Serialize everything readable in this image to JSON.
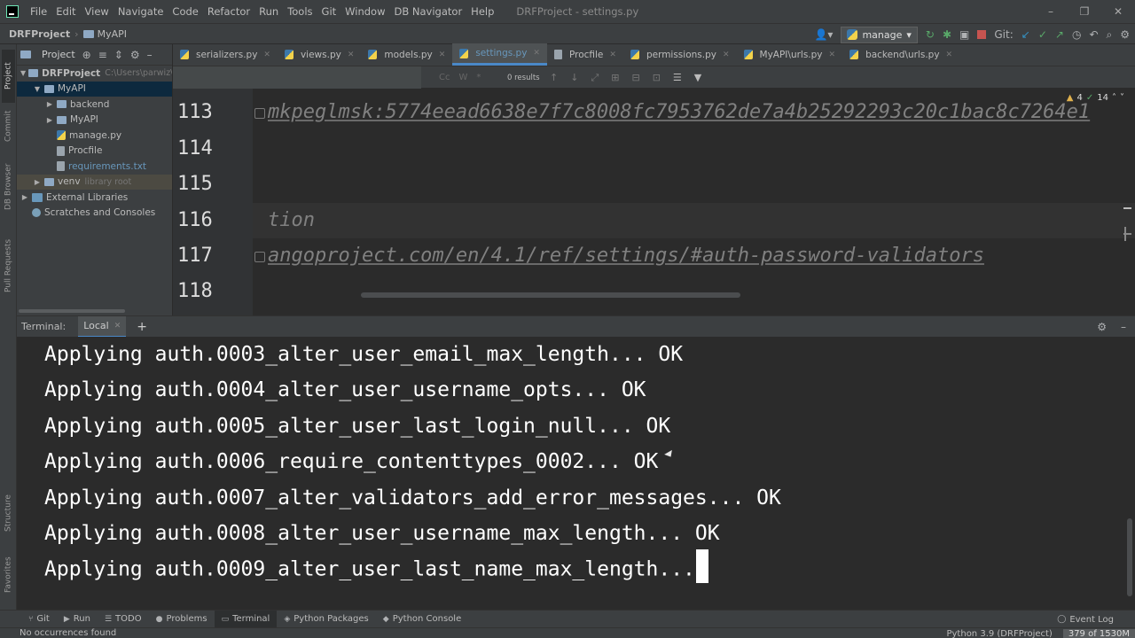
{
  "menu": {
    "items": [
      "File",
      "Edit",
      "View",
      "Navigate",
      "Code",
      "Refactor",
      "Run",
      "Tools",
      "Git",
      "Window",
      "DB Navigator",
      "Help"
    ],
    "window_title": "DRFProject - settings.py",
    "controls": [
      "–",
      "❐",
      "✕"
    ]
  },
  "navbar": {
    "project": "DRFProject",
    "module": "MyAPI",
    "run_config": "manage",
    "git_label": "Git:"
  },
  "left_strip": {
    "project": "Project",
    "commit": "Commit",
    "db_browser": "DB Browser",
    "pull_requests": "Pull Requests",
    "structure": "Structure",
    "favorites": "Favorites"
  },
  "project_panel": {
    "title": "Project",
    "tree": [
      {
        "label": "DRFProject",
        "hint": "C:\\Users\\parwiz\\Py"
      },
      {
        "label": "MyAPI"
      },
      {
        "label": "backend"
      },
      {
        "label": "MyAPI"
      },
      {
        "label": "manage.py"
      },
      {
        "label": "Procfile"
      },
      {
        "label": "requirements.txt"
      },
      {
        "label": "venv",
        "hint": "library root"
      },
      {
        "label": "External Libraries"
      },
      {
        "label": "Scratches and Consoles"
      }
    ]
  },
  "editor": {
    "tabs": [
      "serializers.py",
      "views.py",
      "models.py",
      "settings.py",
      "Procfile",
      "permissions.py",
      "MyAPI\\urls.py",
      "backend\\urls.py"
    ],
    "active_tab": "settings.py",
    "search": {
      "results": "0 results",
      "opt_case": "Cc",
      "opt_word": "W",
      "opt_regex": "*"
    },
    "inspections": {
      "warnings": "4",
      "ok": "14"
    },
    "lines": [
      {
        "num": "113",
        "text": "mkpeglmsk:5774eead6638e7f7c8008fc7953762de7a4b25292293c20c1bac8c7264e1"
      },
      {
        "num": "114",
        "text": ""
      },
      {
        "num": "115",
        "text": ""
      },
      {
        "num": "116",
        "text": "tion"
      },
      {
        "num": "117",
        "text": "angoproject.com/en/4.1/ref/settings/#auth-password-validators"
      },
      {
        "num": "118",
        "text": ""
      }
    ]
  },
  "terminal": {
    "title": "Terminal:",
    "tab": "Local",
    "lines": [
      "Applying auth.0003_alter_user_email_max_length... OK",
      "Applying auth.0004_alter_user_username_opts... OK",
      "Applying auth.0005_alter_user_last_login_null... OK",
      "Applying auth.0006_require_contenttypes_0002... OK",
      "Applying auth.0007_alter_validators_add_error_messages... OK",
      "Applying auth.0008_alter_user_username_max_length... OK",
      "Applying auth.0009_alter_user_last_name_max_length..."
    ]
  },
  "bottom_tools": {
    "git": "Git",
    "run": "Run",
    "todo": "TODO",
    "problems": "Problems",
    "terminal": "Terminal",
    "python_packages": "Python Packages",
    "python_console": "Python Console",
    "event_log": "Event Log"
  },
  "status": {
    "message": "No occurrences found",
    "interpreter": "Python 3.9 (DRFProject)",
    "memory": "379 of 1530M"
  },
  "colors": {
    "accent": "#4a88c7",
    "background": "#2b2b2b",
    "panel": "#3c3f41"
  }
}
